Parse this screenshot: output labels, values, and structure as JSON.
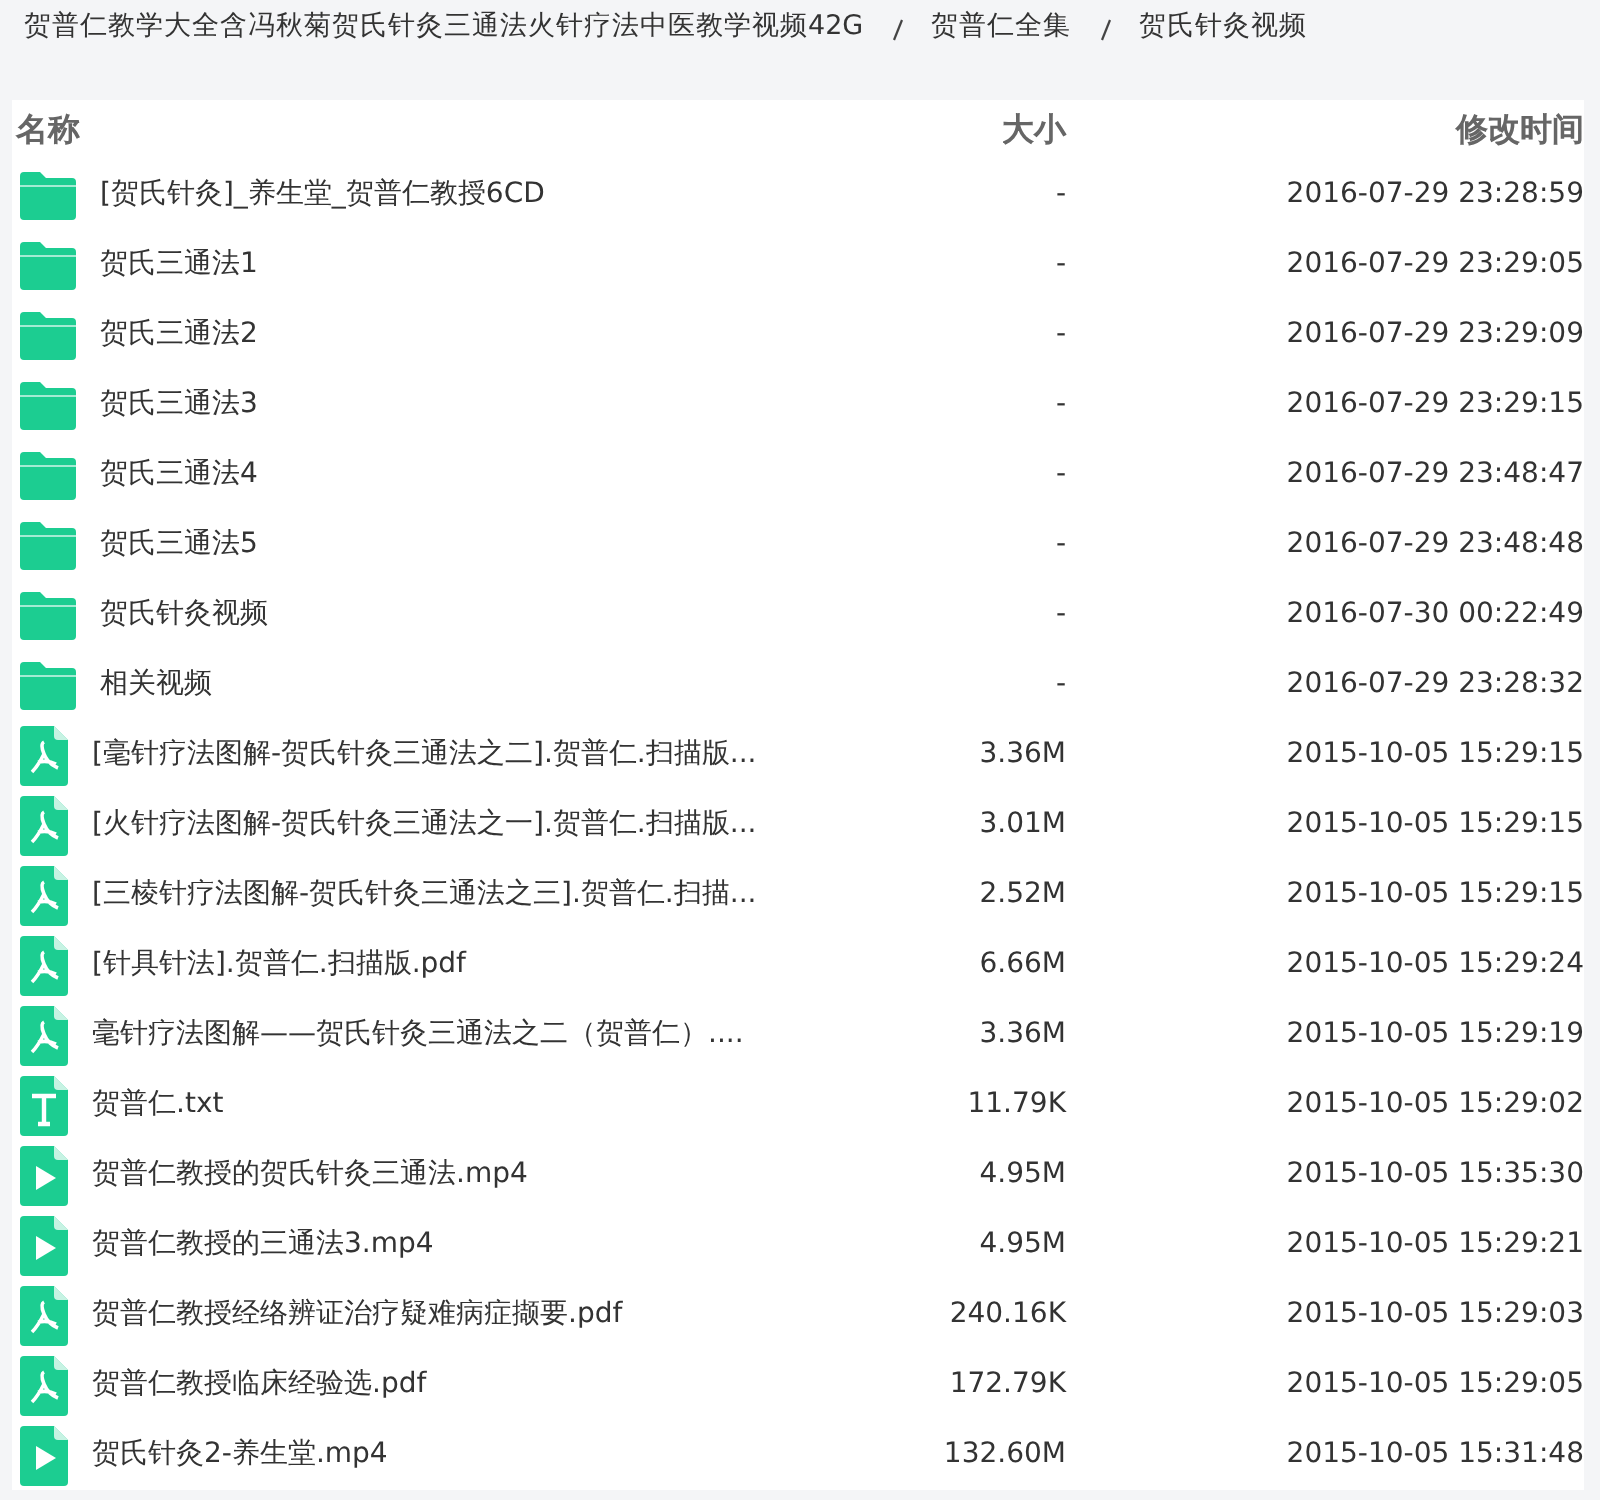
{
  "breadcrumb": [
    "贺普仁教学大全含冯秋菊贺氏针灸三通法火针疗法中医教学视频42G",
    "贺普仁全集",
    "贺氏针灸视频"
  ],
  "columns": [
    "名称",
    "大小",
    "修改时间"
  ],
  "files": [
    {
      "kind": "folder",
      "name": "[贺氏针灸]_养生堂_贺普仁教授6CD",
      "size": "-",
      "modified": "2016-07-29 23:28:59"
    },
    {
      "kind": "folder",
      "name": "贺氏三通法1",
      "size": "-",
      "modified": "2016-07-29 23:29:05"
    },
    {
      "kind": "folder",
      "name": "贺氏三通法2",
      "size": "-",
      "modified": "2016-07-29 23:29:09"
    },
    {
      "kind": "folder",
      "name": "贺氏三通法3",
      "size": "-",
      "modified": "2016-07-29 23:29:15"
    },
    {
      "kind": "folder",
      "name": "贺氏三通法4",
      "size": "-",
      "modified": "2016-07-29 23:48:47"
    },
    {
      "kind": "folder",
      "name": "贺氏三通法5",
      "size": "-",
      "modified": "2016-07-29 23:48:48"
    },
    {
      "kind": "folder",
      "name": "贺氏针灸视频",
      "size": "-",
      "modified": "2016-07-30 00:22:49"
    },
    {
      "kind": "folder",
      "name": "相关视频",
      "size": "-",
      "modified": "2016-07-29 23:28:32"
    },
    {
      "kind": "pdf",
      "name": "[毫针疗法图解-贺氏针灸三通法之二].贺普仁.扫描版...",
      "size": "3.36M",
      "modified": "2015-10-05 15:29:15"
    },
    {
      "kind": "pdf",
      "name": "[火针疗法图解-贺氏针灸三通法之一].贺普仁.扫描版...",
      "size": "3.01M",
      "modified": "2015-10-05 15:29:15"
    },
    {
      "kind": "pdf",
      "name": "[三棱针疗法图解-贺氏针灸三通法之三].贺普仁.扫描...",
      "size": "2.52M",
      "modified": "2015-10-05 15:29:15"
    },
    {
      "kind": "pdf",
      "name": "[针具针法].贺普仁.扫描版.pdf",
      "size": "6.66M",
      "modified": "2015-10-05 15:29:24"
    },
    {
      "kind": "pdf",
      "name": "毫针疗法图解——贺氏针灸三通法之二（贺普仁）....",
      "size": "3.36M",
      "modified": "2015-10-05 15:29:19"
    },
    {
      "kind": "text",
      "name": "贺普仁.txt",
      "size": "11.79K",
      "modified": "2015-10-05 15:29:02"
    },
    {
      "kind": "video",
      "name": "贺普仁教授的贺氏针灸三通法.mp4",
      "size": "4.95M",
      "modified": "2015-10-05 15:35:30"
    },
    {
      "kind": "video",
      "name": "贺普仁教授的三通法3.mp4",
      "size": "4.95M",
      "modified": "2015-10-05 15:29:21"
    },
    {
      "kind": "pdf",
      "name": "贺普仁教授经络辨证治疗疑难病症撷要.pdf",
      "size": "240.16K",
      "modified": "2015-10-05 15:29:03"
    },
    {
      "kind": "pdf",
      "name": "贺普仁教授临床经验选.pdf",
      "size": "172.79K",
      "modified": "2015-10-05 15:29:05"
    },
    {
      "kind": "video",
      "name": "贺氏针灸2-养生堂.mp4",
      "size": "132.60M",
      "modified": "2015-10-05 15:31:48"
    }
  ]
}
